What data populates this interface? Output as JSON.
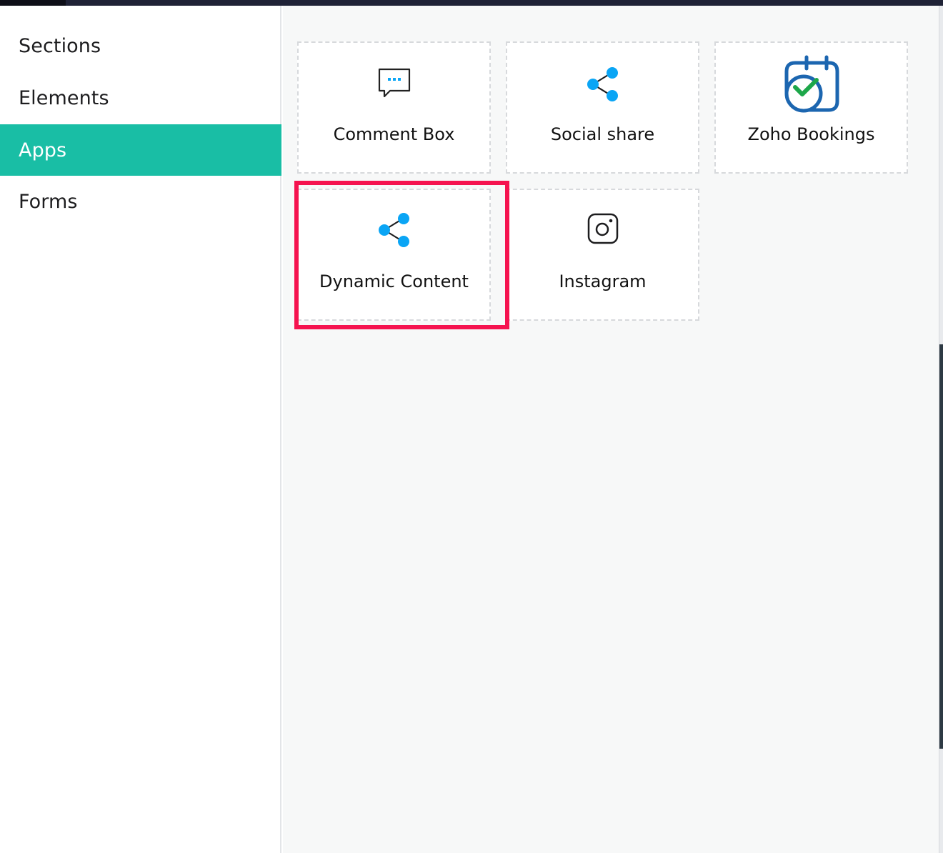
{
  "sidebar": {
    "items": [
      {
        "label": "Sections",
        "active": false
      },
      {
        "label": "Elements",
        "active": false
      },
      {
        "label": "Apps",
        "active": true
      },
      {
        "label": "Forms",
        "active": false
      }
    ]
  },
  "apps": {
    "items": [
      {
        "label": "Comment Box",
        "icon": "comment-box-icon"
      },
      {
        "label": "Social share",
        "icon": "share-icon"
      },
      {
        "label": "Zoho Bookings",
        "icon": "zoho-bookings-icon"
      },
      {
        "label": "Dynamic Content",
        "icon": "share-icon",
        "highlighted": true
      },
      {
        "label": "Instagram",
        "icon": "instagram-icon"
      }
    ]
  },
  "colors": {
    "accent": "#19bea5",
    "highlight": "#f5134f",
    "icon_blue": "#0aa5f5",
    "zoho_blue": "#1c66b0",
    "zoho_green": "#1da74a"
  }
}
